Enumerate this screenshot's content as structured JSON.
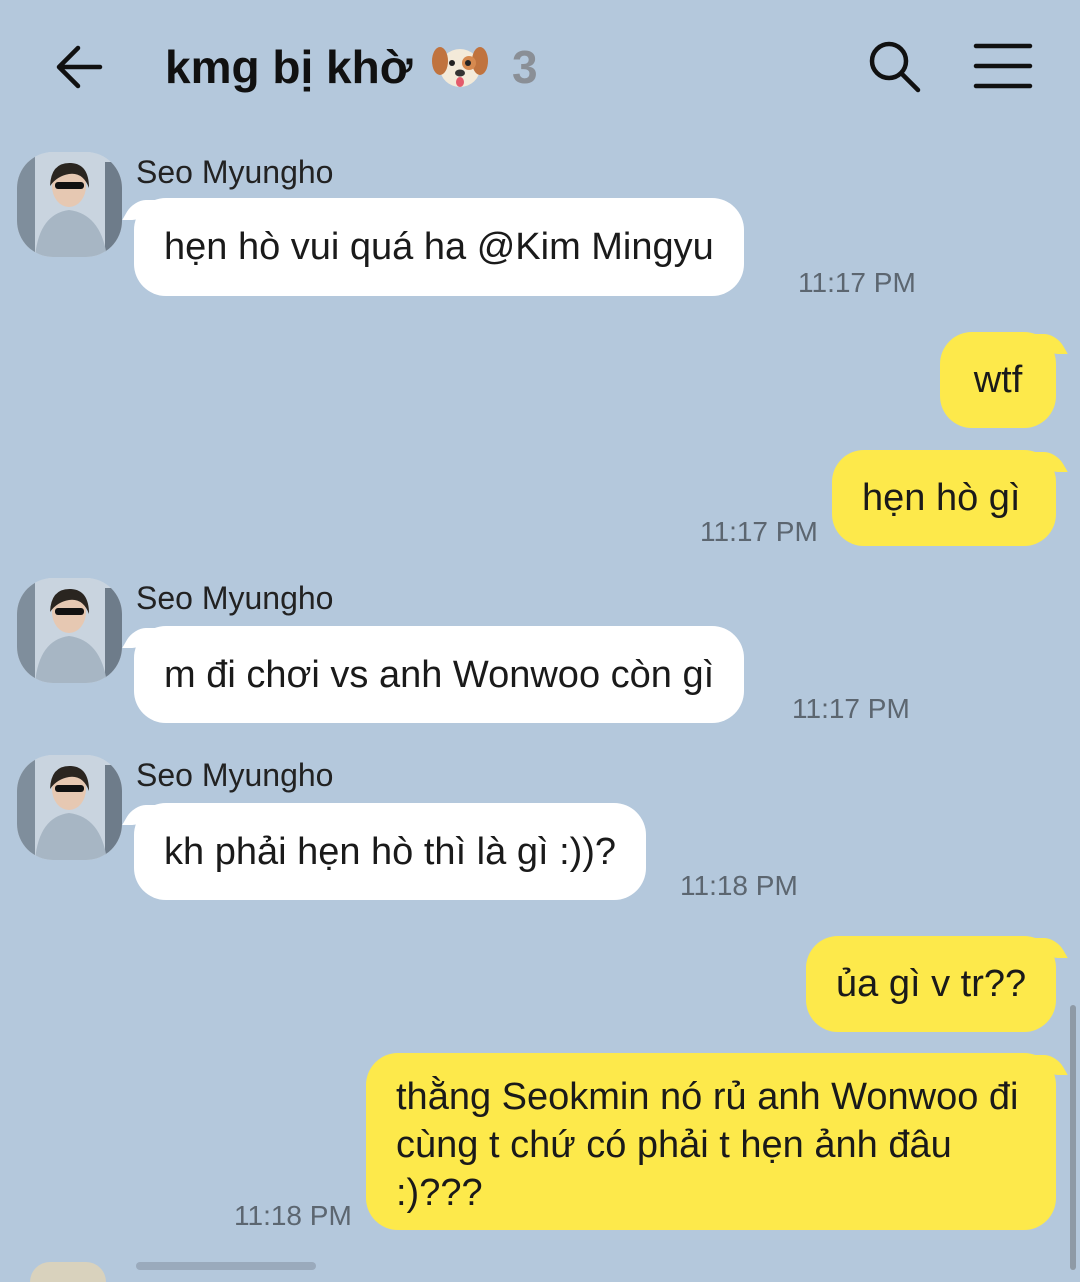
{
  "header": {
    "title": "kmg bị khờ",
    "member_count": "3",
    "back_icon": "arrow-left-icon",
    "emoji_icon": "dog-face-icon",
    "search_icon": "search-icon",
    "menu_icon": "hamburger-menu-icon"
  },
  "colors": {
    "background": "#b4c8dc",
    "incoming_bubble": "#ffffff",
    "outgoing_bubble": "#fde94b",
    "timestamp": "#5c6670"
  },
  "messages": [
    {
      "direction": "in",
      "sender": "Seo Myungho",
      "text": "hẹn hò vui quá ha @Kim Mingyu",
      "time": "11:17 PM"
    },
    {
      "direction": "out",
      "text": "wtf",
      "time": ""
    },
    {
      "direction": "out",
      "text": "hẹn hò gì",
      "time": "11:17 PM"
    },
    {
      "direction": "in",
      "sender": "Seo Myungho",
      "text": "m đi chơi vs anh Wonwoo còn gì",
      "time": "11:17 PM"
    },
    {
      "direction": "in",
      "sender": "Seo Myungho",
      "text": "kh phải hẹn hò thì là gì :))?",
      "time": "11:18 PM"
    },
    {
      "direction": "out",
      "text": "ủa gì v tr??",
      "time": ""
    },
    {
      "direction": "out",
      "text": "thằng Seokmin nó rủ anh Wonwoo đi cùng t chứ có phải t hẹn ảnh đâu :)???",
      "time": "11:18 PM"
    }
  ]
}
